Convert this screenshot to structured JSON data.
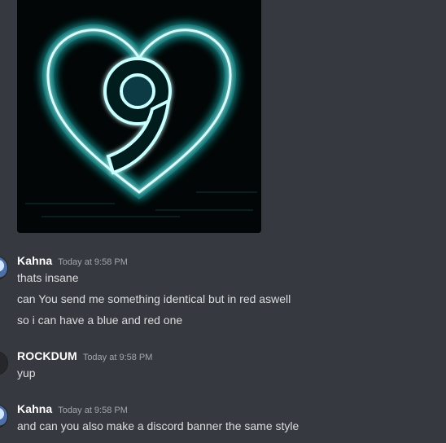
{
  "attachment": {
    "description_icon": "neon-heart-9-image"
  },
  "messages": [
    {
      "author": "Kahna",
      "timestamp": "Today at 9:58 PM",
      "lines": [
        "thats insane",
        "can You send me something identical but in red aswell",
        "so i can have a blue and red one"
      ]
    },
    {
      "author": "ROCKDUM",
      "timestamp": "Today at 9:58 PM",
      "lines": [
        "yup"
      ]
    },
    {
      "author": "Kahna",
      "timestamp": "Today at 9:58 PM",
      "lines": [
        "and can you also make a discord banner the same style"
      ]
    }
  ],
  "colors": {
    "background": "#36393f",
    "username": "#ffffff",
    "text": "#dcddde",
    "timestamp": "#a3a6aa",
    "neon": "#40e0e0"
  }
}
